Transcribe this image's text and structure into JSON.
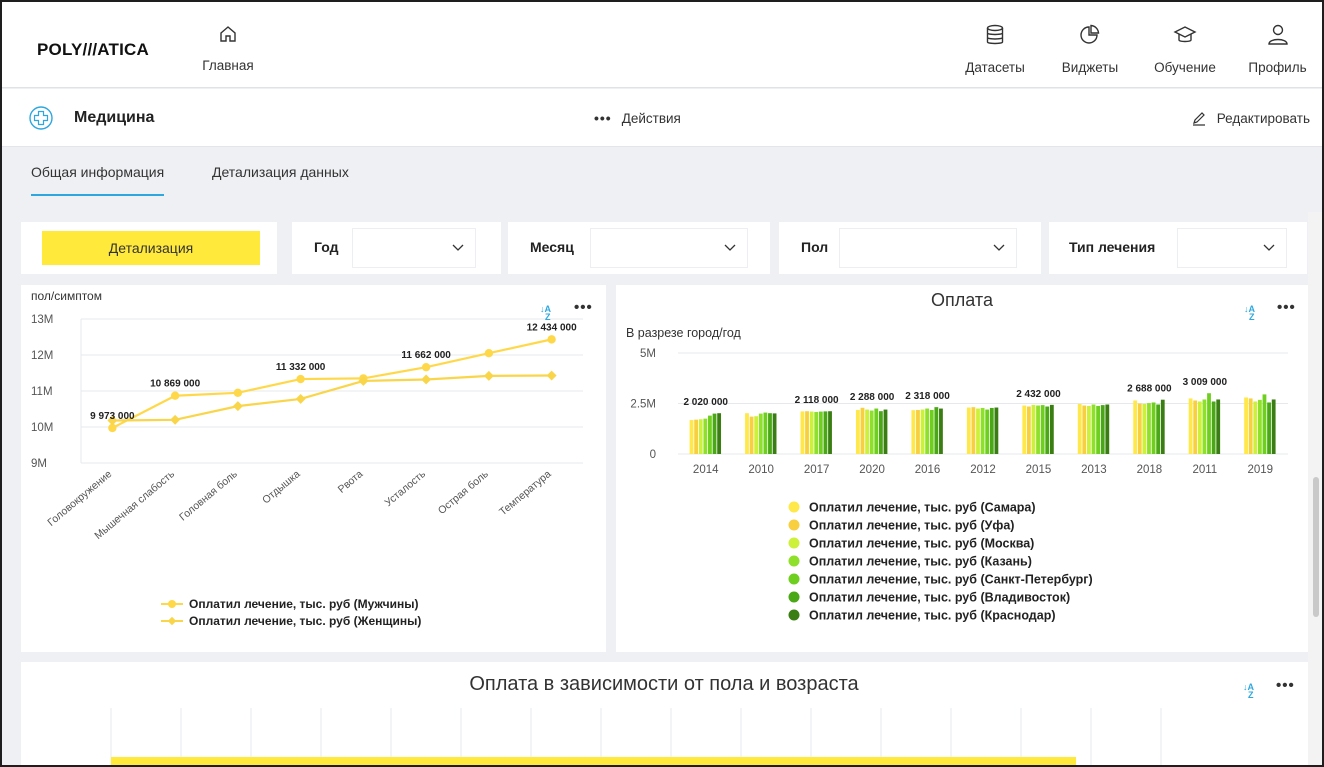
{
  "app": {
    "logo": "POLY///ATICA"
  },
  "nav": {
    "home_label": "Главная",
    "datasets_label": "Датасеты",
    "widgets_label": "Виджеты",
    "learning_label": "Обучение",
    "profile_label": "Профиль"
  },
  "header": {
    "title": "Медицина",
    "actions_label": "Действия",
    "edit_label": "Редактировать"
  },
  "tabs": [
    {
      "label": "Общая информация",
      "active": true
    },
    {
      "label": "Детализация данных",
      "active": false
    }
  ],
  "filters": {
    "detail_button": "Детализация",
    "year_label": "Год",
    "month_label": "Месяц",
    "gender_label": "Пол",
    "treatment_label": "Тип лечения"
  },
  "colors": {
    "accent": "#2ea7df",
    "yellow": "#ffe93a",
    "line_men": "#ffd84a",
    "line_women": "#f9d54a"
  },
  "chart_data": [
    {
      "type": "line",
      "title": "пол/симптом",
      "categories": [
        "Головокружение",
        "Мышечная слабость",
        "Головная боль",
        "Отдышка",
        "Рвота",
        "Усталость",
        "Острая боль",
        "Температура"
      ],
      "ylim": [
        9000000,
        13000000
      ],
      "yticks": [
        "9M",
        "10M",
        "11M",
        "12M",
        "13M"
      ],
      "grid": true,
      "legend_position": "bottom",
      "series": [
        {
          "name": "Оплатил лечение, тыс. руб (Мужчины)",
          "values": [
            9973000,
            10869000,
            10950000,
            11332000,
            11350000,
            11662000,
            12050000,
            12434000
          ],
          "color": "#ffd84a"
        },
        {
          "name": "Оплатил лечение, тыс. руб (Женщины)",
          "values": [
            10180000,
            10200000,
            10580000,
            10780000,
            11280000,
            11320000,
            11420000,
            11430000
          ],
          "color": "#f9d54a"
        }
      ],
      "data_labels": [
        {
          "index": 0,
          "text": "9 973 000"
        },
        {
          "index": 1,
          "text": "10 869 000"
        },
        {
          "index": 3,
          "text": "11 332 000"
        },
        {
          "index": 5,
          "text": "11 662 000"
        },
        {
          "index": 7,
          "text": "12 434 000"
        }
      ]
    },
    {
      "type": "bar",
      "title": "Оплата",
      "subtitle": "В разрезе город/год",
      "categories": [
        "2014",
        "2010",
        "2017",
        "2020",
        "2016",
        "2012",
        "2015",
        "2013",
        "2018",
        "2011",
        "2019"
      ],
      "ylim": [
        0,
        5000000
      ],
      "yticks": [
        "0",
        "2.5M",
        "5M"
      ],
      "grid": true,
      "legend_position": "bottom",
      "top_labels": [
        "2 020 000",
        "",
        "2 118 000",
        "2 288 000",
        "2 318 000",
        "",
        "2 432 000",
        "",
        "2 688 000",
        "3 009 000",
        ""
      ],
      "series": [
        {
          "name": "Оплатил лечение, тыс. руб (Самара)",
          "color": "#ffe84a",
          "values": [
            1680000,
            2020000,
            2110000,
            2180000,
            2170000,
            2300000,
            2400000,
            2480000,
            2650000,
            2750000,
            2800000
          ]
        },
        {
          "name": "Оплатил лечение, тыс. руб (Уфа)",
          "color": "#f7cf3f",
          "values": [
            1700000,
            1850000,
            2118000,
            2288000,
            2180000,
            2318000,
            2350000,
            2400000,
            2500000,
            2650000,
            2750000
          ]
        },
        {
          "name": "Оплатил лечение, тыс. руб (Москва)",
          "color": "#cdf03a",
          "values": [
            1720000,
            1870000,
            2100000,
            2200000,
            2200000,
            2250000,
            2430000,
            2380000,
            2480000,
            2600000,
            2600000
          ]
        },
        {
          "name": "Оплатил лечение, тыс. руб (Казань)",
          "color": "#8fe02a",
          "values": [
            1750000,
            2000000,
            2080000,
            2150000,
            2250000,
            2280000,
            2400000,
            2450000,
            2520000,
            2700000,
            2680000
          ]
        },
        {
          "name": "Оплатил лечение, тыс. руб (Санкт-Петербург)",
          "color": "#6fcf1f",
          "values": [
            1900000,
            2050000,
            2100000,
            2250000,
            2180000,
            2200000,
            2420000,
            2380000,
            2550000,
            3009000,
            2950000
          ]
        },
        {
          "name": "Оплатил лечение, тыс. руб (Владивосток)",
          "color": "#4aa716",
          "values": [
            2000000,
            2020000,
            2110000,
            2120000,
            2320000,
            2280000,
            2350000,
            2420000,
            2450000,
            2600000,
            2550000
          ]
        },
        {
          "name": "Оплатил лечение, тыс. руб (Краснодар)",
          "color": "#3a7d12",
          "values": [
            2020000,
            2010000,
            2118000,
            2200000,
            2250000,
            2300000,
            2432000,
            2450000,
            2688000,
            2700000,
            2700000
          ]
        }
      ]
    },
    {
      "type": "bar",
      "title": "Оплата в зависимости от пола и возраста",
      "grid": true
    }
  ]
}
